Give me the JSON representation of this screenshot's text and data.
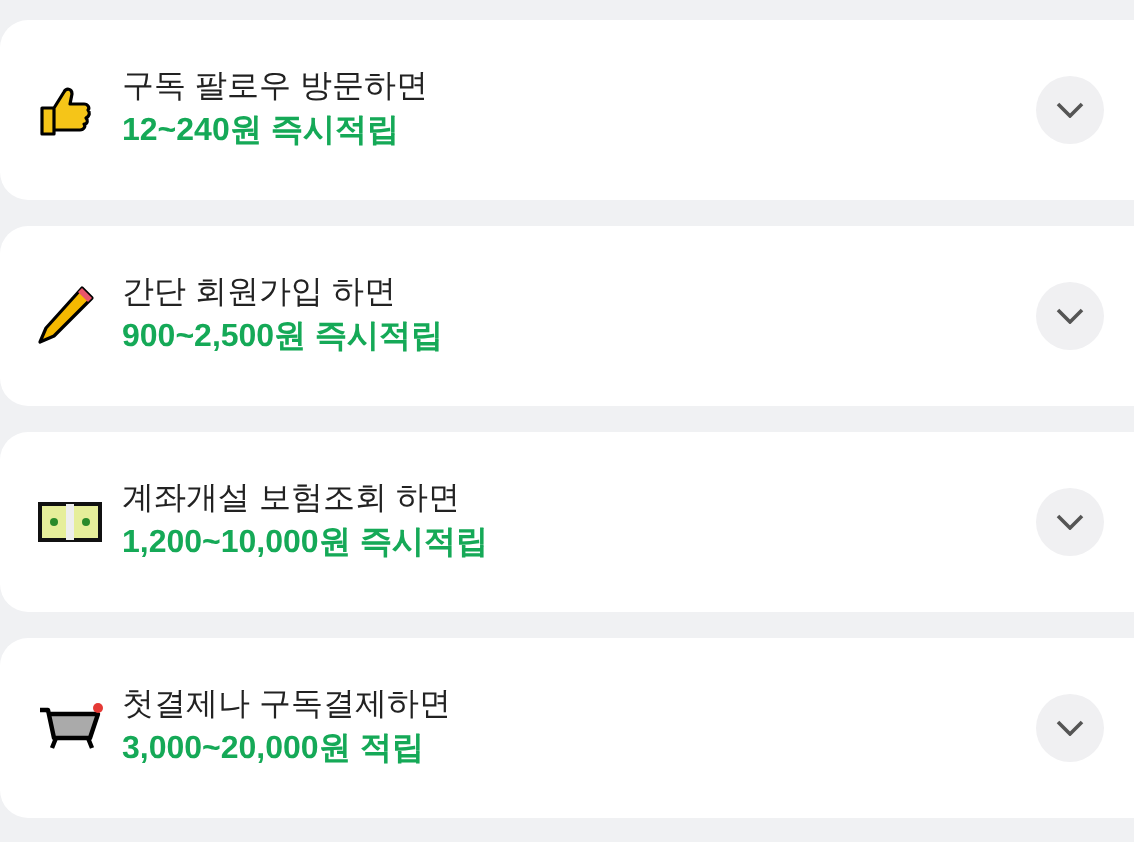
{
  "rewards": [
    {
      "title": "구독 팔로우 방문하면",
      "reward": "12~240원 즉시적립",
      "expanded": false
    },
    {
      "title": "간단 회원가입 하면",
      "reward": "900~2,500원 즉시적립",
      "expanded": false
    },
    {
      "title": "계좌개설 보험조회 하면",
      "reward": "1,200~10,000원 즉시적립",
      "expanded": false
    },
    {
      "title": "첫결제나 구독결제하면",
      "reward": "3,000~20,000원 적립",
      "expanded": false
    }
  ]
}
